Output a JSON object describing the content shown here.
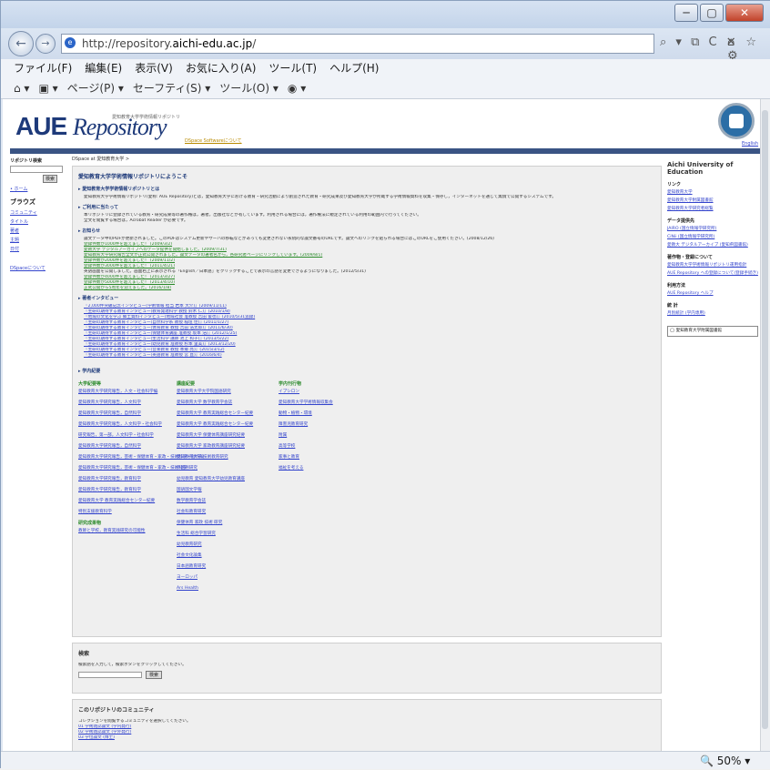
{
  "browser": {
    "url_prefix": "http://repository.",
    "url_host": "aichi-edu.ac.jp",
    "url_suffix": "/",
    "addr_tools": "⌕ ▾ ⧉ C ✕",
    "home_icons": "⌂ ☆ ⚙",
    "menu": [
      "ファイル(F)",
      "編集(E)",
      "表示(V)",
      "お気に入り(A)",
      "ツール(T)",
      "ヘルプ(H)"
    ],
    "cmd": [
      "⌂ ▾",
      "▣ ▾",
      "ページ(P) ▾",
      "セーフティ(S) ▾",
      "ツール(O) ▾",
      "◉ ▾"
    ],
    "zoom": "🔍 50%  ▾",
    "win_min": "─",
    "win_max": "▢",
    "win_close": "✕"
  },
  "header": {
    "logo_aue": "AUE",
    "logo_rep": "Repository",
    "logo_jp": "愛知教育大学学術情報リポジトリ",
    "dspace_link": "DSpace Softwareについて",
    "english": "English"
  },
  "left": {
    "search_head": "リポジトリ検索",
    "go": "検索",
    "home_label": "ホーム",
    "browse": "ブラウズ",
    "browse_items": [
      "コミュニティ",
      "タイトル",
      "著者",
      "主題",
      "日付"
    ],
    "about": "DSpaceについて"
  },
  "main": {
    "crumb": "DSpace at 愛知教育大学 >",
    "welcome": "愛知教育大学学術情報リポジトリにようこそ",
    "sec1": "愛知教育大学学術情報リポジトリとは",
    "sec1_text": "愛知教育大学学術情報リポジトリ(愛称: AUE Repository)とは，愛知教育大学における教育・研究活動により創造された教育・研究成果及び愛知教育大学が所蔵する学術情報資料を収集・保存し，インターネットを通じて無償で公開するシステムです。",
    "sec2": "ご利用に当たって",
    "sec2_lines": [
      "本リポジトリに登録されている教育・研究成果等の著作権は，著者，出版社などが有しています。利用される場合には，著作権法に規定されている利用の範囲内で行ってください。",
      "全文を閲覧する場合は，Acrobat Reader が必要です。"
    ],
    "sec3": "お知らせ",
    "news": [
      {
        "t": "論文データ中のPDFが更新されました。このPDFはシステム更新やサーバの移転などがあっても変更されない永続的な論文番号のURLです。論文へのリンクを貼られる場合にはこのURLをご使用ください。(2008/12/26)",
        "c": "line"
      },
      {
        "t": "登録件数が1000件を超えました！ (2009/3/2)",
        "c": "lk g"
      },
      {
        "t": "愛教大学 デジタルアーカイブへのデータ提供を開始しました。(2009/7/31)",
        "c": "lk g"
      },
      {
        "t": "愛知教育大学研究報告全文が正式公開されました。論文データの著者名から，各研究者ページにリンクしています。(2009/8/1)",
        "c": "lk g"
      },
      {
        "t": "登録件数が2000件を超えました！ (2009/11/2)",
        "c": "lk g"
      },
      {
        "t": "登録件数が3000件を超えました！ (2011/4/21)",
        "c": "lk g"
      },
      {
        "t": "英語画面を公開しました。画面右上に表示される「English／日本語」をクリックすることで表示の言語を変更できるようになりました。(2012/5/31)",
        "c": "line"
      },
      {
        "t": "登録件数が4000件を超えました！ (2013/3/27)",
        "c": "lk g"
      },
      {
        "t": "登録件数が5000件を超えました！ (2013/4/10)",
        "c": "lk g"
      },
      {
        "t": "正式公開から5周年を迎えました。(2016/1/8)",
        "c": "lk g"
      }
    ],
    "sec4": "著者インタビュー",
    "interviews": [
      "『2,000件突破記念インタビュー(学術情報 担当 岩本 大介)』(2009/11/11)",
      "『主研の期待する教育インタビュー(教育発達科学 教授 鈴木 仁)』(2010/1/8)",
      "『地域の文化を学ぶ 郷土資料インタビュー(地域社会 准教授 吉田 俊也)』(2010/5/31追録)",
      "『主研の期待する教育インタビュー(自然科学系 教授 稲垣 佳)』(2011/1/27)",
      "『主研の期待する教育インタビュー(体育教育 教授 吉田 浩太郎)』(2011/6/30)",
      "『主研の期待する教育インタビュー(保健体育講座 准教授 坂本 浩)』(2012/1/25)",
      "『主研の期待する教育インタビュー(生活科学 講師 池上 和子)』(2013/5/22)",
      "『主研の期待する教育インタビュー(幼児教育 准教授 杉本 里美)』(2013/12/20)",
      "『主研の期待する教育インタビュー(音楽教育 教授 本郷 亮)』(2015/3/12)",
      "『主研の期待する教育インタビュー(英語教育 准教授 宮 直)』(2016/6/4)"
    ],
    "sec5": "学内紀要",
    "col1_head": "大学紀要等",
    "col1": [
      "愛知教育大学研究報告，人文・社会科学編",
      "愛知教育大学研究報告，人文科学",
      "愛知教育大学研究報告，自然科学",
      "愛知教育大学研究報告，人文科学・社会科学",
      "研究報告，第一部，人文科学・社会科学",
      "愛知教育大学研究報告，自然科学",
      "愛知教育大学研究報告，芸術・保健体育・家政・技術科学・創作編",
      "愛知教育大学研究報告，芸術・保健体育・家政・技術科学",
      "愛知教育大学研究報告，教育科学",
      "愛知教育大学研究報告，教育科学",
      "愛知教育大学 教育実践総合センター紀要",
      "特別支援教育科学"
    ],
    "col1_head2": "研究成果物",
    "col1b": [
      "教師と学校，教育実践研究の可能性"
    ],
    "col2_head": "講座紀要",
    "col2": [
      "愛知教育大学大学院国語研究",
      "愛知教育大学 数学教育学会誌",
      "愛知教育大学 教育実践総合センター紀要",
      "愛知教育大学 教育実践総合センター紀要",
      "愛知教育大学 保健体育講座研究紀要",
      "愛知教育大学 家政教育講座研究紀要",
      "愛知教育大学 技術教育研究",
      "外国語研究",
      "幼児教育 愛知教育大学幼児教育講座",
      "国語国文学報",
      "数学教育学会誌",
      "社会科教育研究",
      "保健体育 家政 技術 研究",
      "生活科 総合学習研究",
      "幼児教育研究",
      "社会文化論集",
      "日本語教育研究",
      "ヨーロッパ",
      "Ars Health"
    ],
    "col3_head": "学内刊行物",
    "col3": [
      "イプシロン",
      "愛知教育大学学術情報収集会",
      "動物・植物・環境",
      "障害児教育研究",
      "附属",
      "高等学校",
      "家事と教育",
      "福祉を考える"
    ],
    "search_box_title": "検索",
    "search_hint": "検索語を入力して，検索ボタンをクリックしてください。",
    "search_btn": "検索",
    "comm_title": "このリポジトリのコミュニティ",
    "comm_hint": "コレクションを閲覧するコミュニティを選択してください。",
    "comm_items": [
      "01 学術雑誌論文 (学内発行)",
      "02 学術雑誌論文 (学外発行)",
      "03 学位論文 (博士)"
    ]
  },
  "right": {
    "title": "Aichi University of Education",
    "links_head": "リンク",
    "links": [
      "愛知教育大学",
      "愛知教育大学附属図書館",
      "愛知教育大学研究者総覧"
    ],
    "data_head": "データ提供先",
    "data_links": [
      "JAIRO (国立情報学研究所)",
      "CiNii (国立情報学研究所)",
      "愛教大 デジタルアーカイブ (愛知県図書館)"
    ],
    "reg_head": "著作物・登録について",
    "reg_links": [
      "愛知教育大学学術情報リポジトリ運用指針",
      "AUE Repository への登録について(登録手続き)"
    ],
    "manual_head": "利用方法",
    "manual_links": [
      "AUE Repository ヘルプ"
    ],
    "stats_head": "統 計",
    "stats_links": [
      "月別統計 (学内専用)"
    ],
    "footer_logo": "◯ 愛知教育大学附属図書館"
  }
}
